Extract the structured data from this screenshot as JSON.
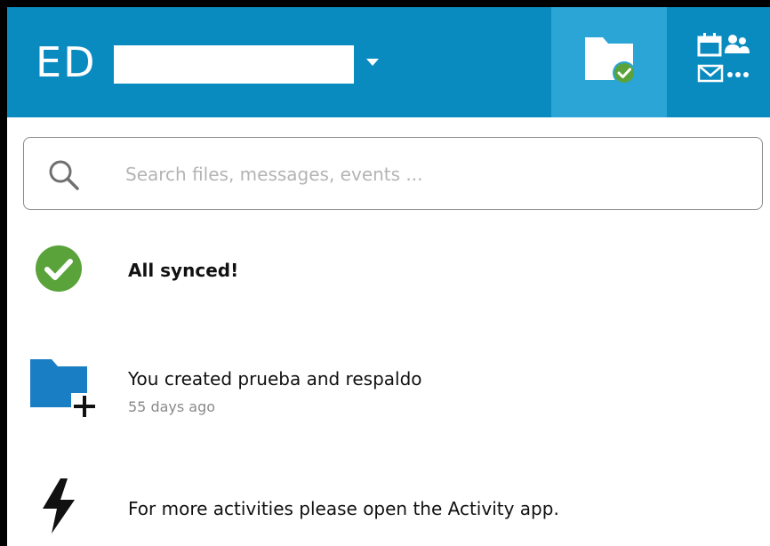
{
  "header": {
    "avatar_initials": "ED",
    "account_name": "",
    "brand_color": "#0a8bc0",
    "active_tab_color": "#2aa5d6",
    "files_button_icon": "folder-check-icon",
    "apps_button_icons": [
      "calendar-icon",
      "contacts-icon",
      "mail-icon",
      "more-icon"
    ]
  },
  "search": {
    "placeholder": "Search files, messages, events ...",
    "value": ""
  },
  "activity": {
    "sync_status": {
      "icon": "check-circle-icon",
      "text": "All synced!",
      "color": "#5aa33a"
    },
    "items": [
      {
        "icon": "folder-add-icon",
        "text": "You created prueba and respaldo",
        "time": "55 days ago"
      }
    ],
    "more": {
      "icon": "lightning-icon",
      "text": "For more activities please open the Activity app."
    }
  }
}
